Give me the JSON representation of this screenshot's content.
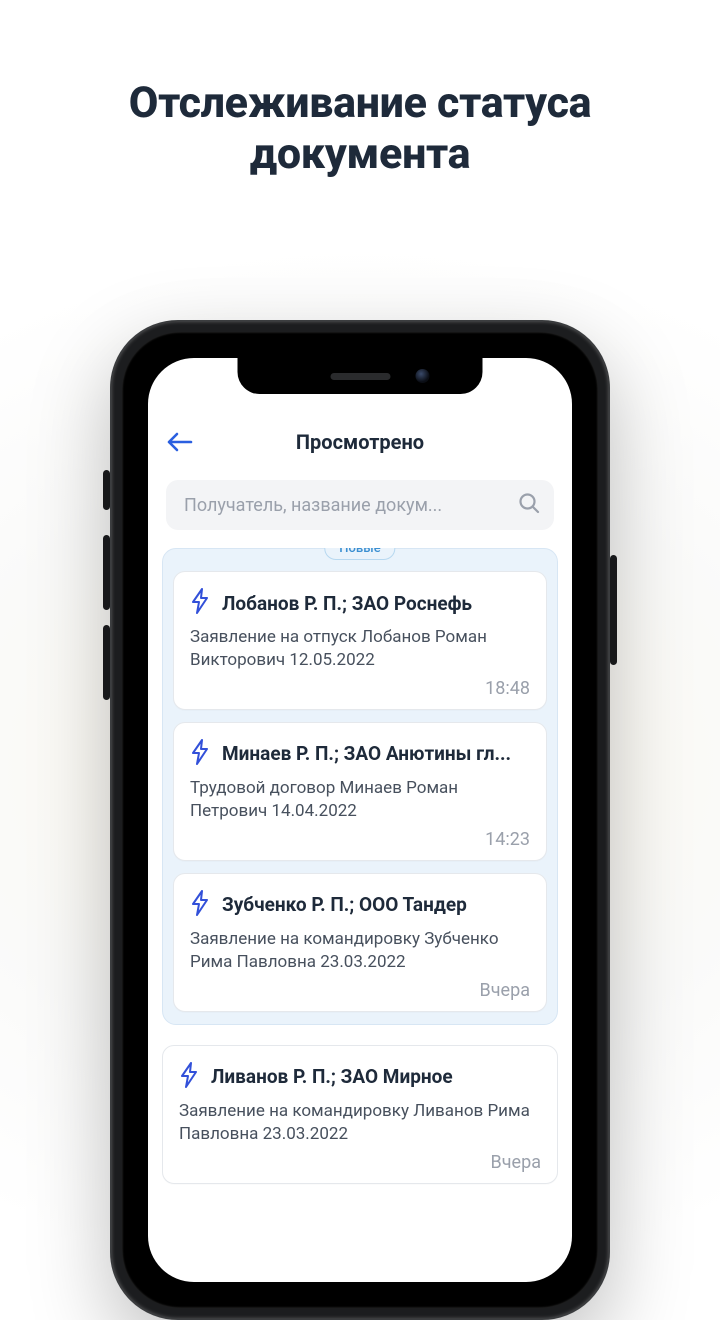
{
  "promo": {
    "title_line1": "Отслеживание статуса",
    "title_line2": "документа"
  },
  "header": {
    "title": "Просмотрено"
  },
  "search": {
    "placeholder": "Получатель, название докум..."
  },
  "sections": [
    {
      "badge": "Новые",
      "tinted": true,
      "cards": [
        {
          "title": "Лобанов Р. П.;  ЗАО Роснефь",
          "subtitle": "Заявление на отпуск Лобанов Роман Викторович 12.05.2022",
          "time": "18:48"
        },
        {
          "title": "Минаев Р. П.;  ЗАО Анютины гл...",
          "subtitle": "Трудовой договор Минаев Роман Петрович 14.04.2022",
          "time": "14:23"
        },
        {
          "title": "Зубченко Р. П.;  ООО Тандер",
          "subtitle": "Заявление на командировку Зубченко Рима Павловна 23.03.2022",
          "time": "Вчера"
        }
      ]
    },
    {
      "badge": null,
      "tinted": false,
      "cards": [
        {
          "title": "Ливанов Р. П.;  ЗАО Мирное",
          "subtitle": "Заявление на командировку Ливанов Рима Павловна 23.03.2022",
          "time": "Вчера"
        }
      ]
    }
  ],
  "colors": {
    "accent": "#2a5fe0",
    "bolt": "#3250d9"
  }
}
